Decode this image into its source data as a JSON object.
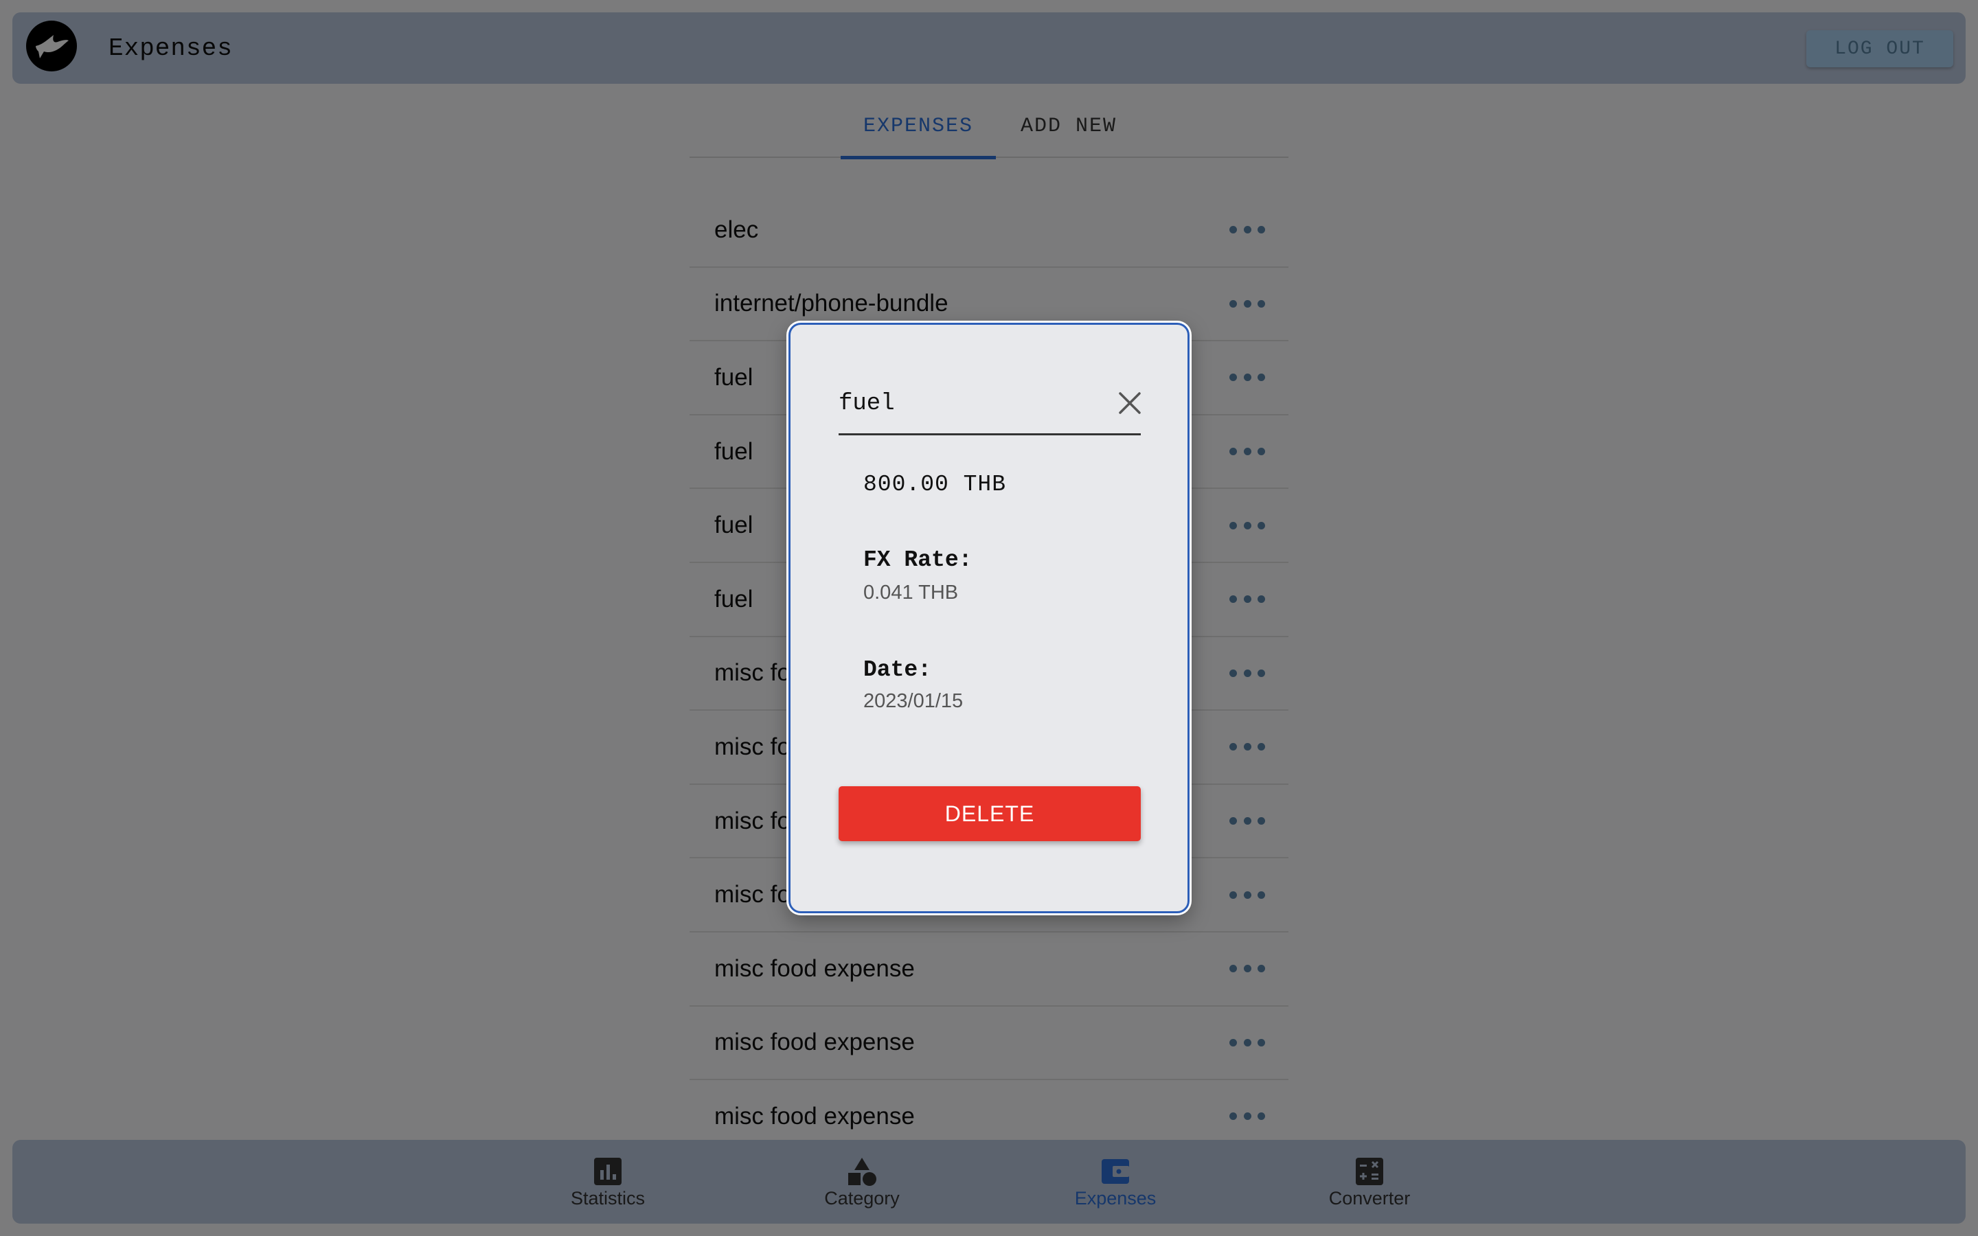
{
  "header": {
    "title": "Expenses",
    "logout_label": "LOG OUT"
  },
  "tabs": [
    {
      "label": "EXPENSES",
      "active": true
    },
    {
      "label": "ADD NEW",
      "active": false
    }
  ],
  "expenses": [
    {
      "name": "elec"
    },
    {
      "name": "internet/phone-bundle"
    },
    {
      "name": "fuel"
    },
    {
      "name": "fuel"
    },
    {
      "name": "fuel"
    },
    {
      "name": "fuel"
    },
    {
      "name": "misc food expense"
    },
    {
      "name": "misc food expense"
    },
    {
      "name": "misc food expense"
    },
    {
      "name": "misc food expense"
    },
    {
      "name": "misc food expense"
    },
    {
      "name": "misc food expense"
    },
    {
      "name": "misc food expense"
    }
  ],
  "dialog": {
    "title": "fuel",
    "amount": "800.00 THB",
    "fx_rate_label": "FX Rate:",
    "fx_rate_value": "0.041 THB",
    "date_label": "Date:",
    "date_value": "2023/01/15",
    "delete_label": "DELETE"
  },
  "bottom_nav": [
    {
      "label": "Statistics",
      "icon": "bar-chart-icon",
      "active": false
    },
    {
      "label": "Category",
      "icon": "shapes-icon",
      "active": false
    },
    {
      "label": "Expenses",
      "icon": "wallet-icon",
      "active": true
    },
    {
      "label": "Converter",
      "icon": "calculator-icon",
      "active": false
    }
  ],
  "colors": {
    "accent": "#2d6fd6",
    "bar_background": "#b9c6dc",
    "delete": "#e8332a",
    "more_dots": "#5b84a8"
  }
}
